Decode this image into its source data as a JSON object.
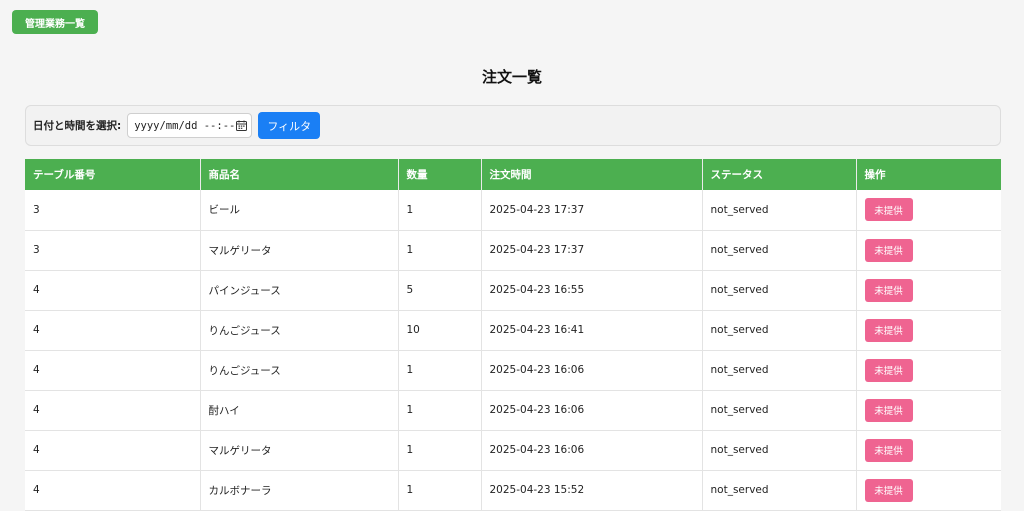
{
  "header": {
    "admin_button": "管理業務一覧"
  },
  "page_title": "注文一覧",
  "filter": {
    "label": "日付と時間を選択:",
    "date_placeholder": "yyyy/mm/dd --:--",
    "button": "フィルタ"
  },
  "table": {
    "columns": [
      "テーブル番号",
      "商品名",
      "数量",
      "注文時間",
      "ステータス",
      "操作"
    ],
    "rows": [
      {
        "table": "3",
        "item": "ビール",
        "qty": "1",
        "time": "2025-04-23 17:37",
        "status": "not_served",
        "action": "未提供"
      },
      {
        "table": "3",
        "item": "マルゲリータ",
        "qty": "1",
        "time": "2025-04-23 17:37",
        "status": "not_served",
        "action": "未提供"
      },
      {
        "table": "4",
        "item": "パインジュース",
        "qty": "5",
        "time": "2025-04-23 16:55",
        "status": "not_served",
        "action": "未提供"
      },
      {
        "table": "4",
        "item": "りんごジュース",
        "qty": "10",
        "time": "2025-04-23 16:41",
        "status": "not_served",
        "action": "未提供"
      },
      {
        "table": "4",
        "item": "りんごジュース",
        "qty": "1",
        "time": "2025-04-23 16:06",
        "status": "not_served",
        "action": "未提供"
      },
      {
        "table": "4",
        "item": "酎ハイ",
        "qty": "1",
        "time": "2025-04-23 16:06",
        "status": "not_served",
        "action": "未提供"
      },
      {
        "table": "4",
        "item": "マルゲリータ",
        "qty": "1",
        "time": "2025-04-23 16:06",
        "status": "not_served",
        "action": "未提供"
      },
      {
        "table": "4",
        "item": "カルボナーラ",
        "qty": "1",
        "time": "2025-04-23 15:52",
        "status": "not_served",
        "action": "未提供"
      }
    ]
  },
  "colors": {
    "primary_green": "#4caf50",
    "filter_blue": "#1a7ff5",
    "not_served_pink": "#ef6491"
  },
  "icons": {
    "date_picker": "calendar-icon"
  }
}
